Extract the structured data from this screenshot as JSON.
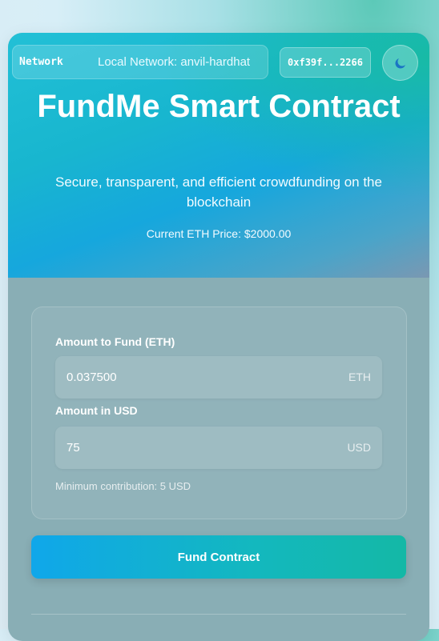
{
  "network": {
    "label": "Network",
    "value": "Local Network: anvil-hardhat"
  },
  "wallet": {
    "address": "0xf39f...2266"
  },
  "theme_toggle": {
    "icon": "moon-icon"
  },
  "hero": {
    "title": "FundMe Smart Contract",
    "subtitle": "Secure, transparent, and efficient crowdfunding on the blockchain",
    "price": "Current ETH Price: $2000.00"
  },
  "form": {
    "eth_label": "Amount to Fund (ETH)",
    "eth_value": "0.037500",
    "eth_unit": "ETH",
    "usd_label": "Amount in USD",
    "usd_value": "75",
    "usd_unit": "USD",
    "hint": "Minimum contribution: 5 USD"
  },
  "actions": {
    "fund_label": "Fund Contract"
  },
  "colors": {
    "accent_start": "#10a7ea",
    "accent_end": "#14b8a6",
    "moon": "#1a74c4"
  }
}
